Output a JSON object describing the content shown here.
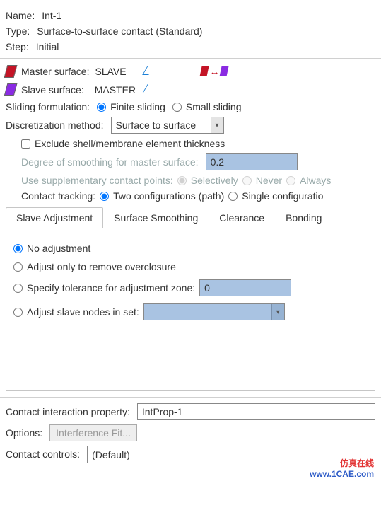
{
  "header": {
    "name_label": "Name:",
    "name_value": "Int-1",
    "type_label": "Type:",
    "type_value": "Surface-to-surface contact (Standard)",
    "step_label": "Step:",
    "step_value": "Initial"
  },
  "surfaces": {
    "master_label": "Master surface:",
    "master_value": "SLAVE",
    "slave_label": "Slave surface:",
    "slave_value": "MASTER"
  },
  "sliding": {
    "label": "Sliding formulation:",
    "finite": "Finite sliding",
    "small": "Small sliding"
  },
  "discretization": {
    "label": "Discretization method:",
    "value": "Surface to surface"
  },
  "options": {
    "exclude": "Exclude shell/membrane element thickness",
    "smoothing_label": "Degree of smoothing for master surface:",
    "smoothing_value": "0.2",
    "supplementary_label": "Use supplementary contact points:",
    "selectively": "Selectively",
    "never": "Never",
    "always": "Always",
    "tracking_label": "Contact tracking:",
    "two_config": "Two configurations (path)",
    "single_config": "Single configuratio"
  },
  "tabs": {
    "slave_adj": "Slave Adjustment",
    "smoothing": "Surface Smoothing",
    "clearance": "Clearance",
    "bonding": "Bonding"
  },
  "adjust": {
    "none": "No adjustment",
    "overclosure": "Adjust only to remove overclosure",
    "tolerance_label": "Specify tolerance for adjustment zone:",
    "tolerance_value": "0",
    "in_set": "Adjust slave nodes in set:"
  },
  "bottom": {
    "prop_label": "Contact interaction property:",
    "prop_value": "IntProp-1",
    "options_label": "Options:",
    "interference_btn": "Interference Fit...",
    "controls_label": "Contact controls:",
    "controls_value": "(Default)"
  },
  "footer": {
    "line1": "仿真在线",
    "line2": "www.1CAE.com"
  }
}
